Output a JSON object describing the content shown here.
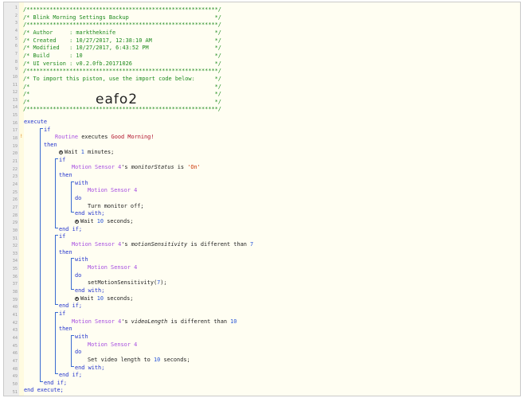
{
  "header_comments": [
    "/**********************************************************/",
    "/* Blink Morning Settings Backup                          */",
    "/**********************************************************/",
    "/* Author     : marktheknife                              */",
    "/* Created    : 10/27/2017, 12:38:10 AM                   */",
    "/* Modified   : 10/27/2017, 6:43:52 PM                    */",
    "/* Build      : 10                                        */",
    "/* UI version : v0.2.0fb.20171026                         */",
    "/**********************************************************/",
    "/* To import this piston, use the import code below:      */",
    "/*                                                        */",
    "/*                                                        */",
    "/*                                                        */",
    "/**********************************************************/"
  ],
  "import_code": "eafo2",
  "warning_icon": "!",
  "kw": {
    "execute": "execute",
    "if": "if",
    "then": "then",
    "with": "with",
    "do": "do",
    "end_with": "end with;",
    "end_if": "end if;",
    "end_execute": "end execute;"
  },
  "routine": {
    "device": "Routine",
    "text": " executes ",
    "value": "Good Morning!"
  },
  "wait1": {
    "text": "Wait ",
    "num": "1",
    "unit": " minutes;"
  },
  "cond1": {
    "device": "Motion Sensor 4",
    "pre": "'s ",
    "attr": "monitorStatus",
    "op": " is ",
    "value": "'On'"
  },
  "with1": "Motion Sensor 4",
  "action1": "Turn monitor off;",
  "wait2": {
    "text": "Wait ",
    "num": "10",
    "unit": " seconds;"
  },
  "cond2": {
    "device": "Motion Sensor 4",
    "pre": "'s ",
    "attr": "motionSensitivity",
    "op": " is different than ",
    "value": "7"
  },
  "with2": "Motion Sensor 4",
  "action2": {
    "pre": "setMotionSensitivity(",
    "num": "7",
    "post": ");"
  },
  "wait3": {
    "text": "Wait ",
    "num": "10",
    "unit": " seconds;"
  },
  "cond3": {
    "device": "Motion Sensor 4",
    "pre": "'s ",
    "attr": "videoLength",
    "op": " is different than ",
    "value": "10"
  },
  "with3": "Motion Sensor 4",
  "action3": {
    "pre": "Set video length to ",
    "num": "10",
    "post": " seconds;"
  },
  "line_numbers": [
    "1",
    "2",
    "3",
    "4",
    "5",
    "6",
    "7",
    "8",
    "9",
    "10",
    "11",
    "12",
    "13",
    "14",
    "15",
    "16",
    "17",
    "18",
    "19",
    "20",
    "21",
    "22",
    "23",
    "24",
    "25",
    "26",
    "27",
    "28",
    "29",
    "30",
    "31",
    "32",
    "33",
    "34",
    "35",
    "36",
    "37",
    "38",
    "39",
    "40",
    "41",
    "42",
    "43",
    "44",
    "45",
    "46",
    "47",
    "48",
    "49",
    "50",
    "51"
  ]
}
